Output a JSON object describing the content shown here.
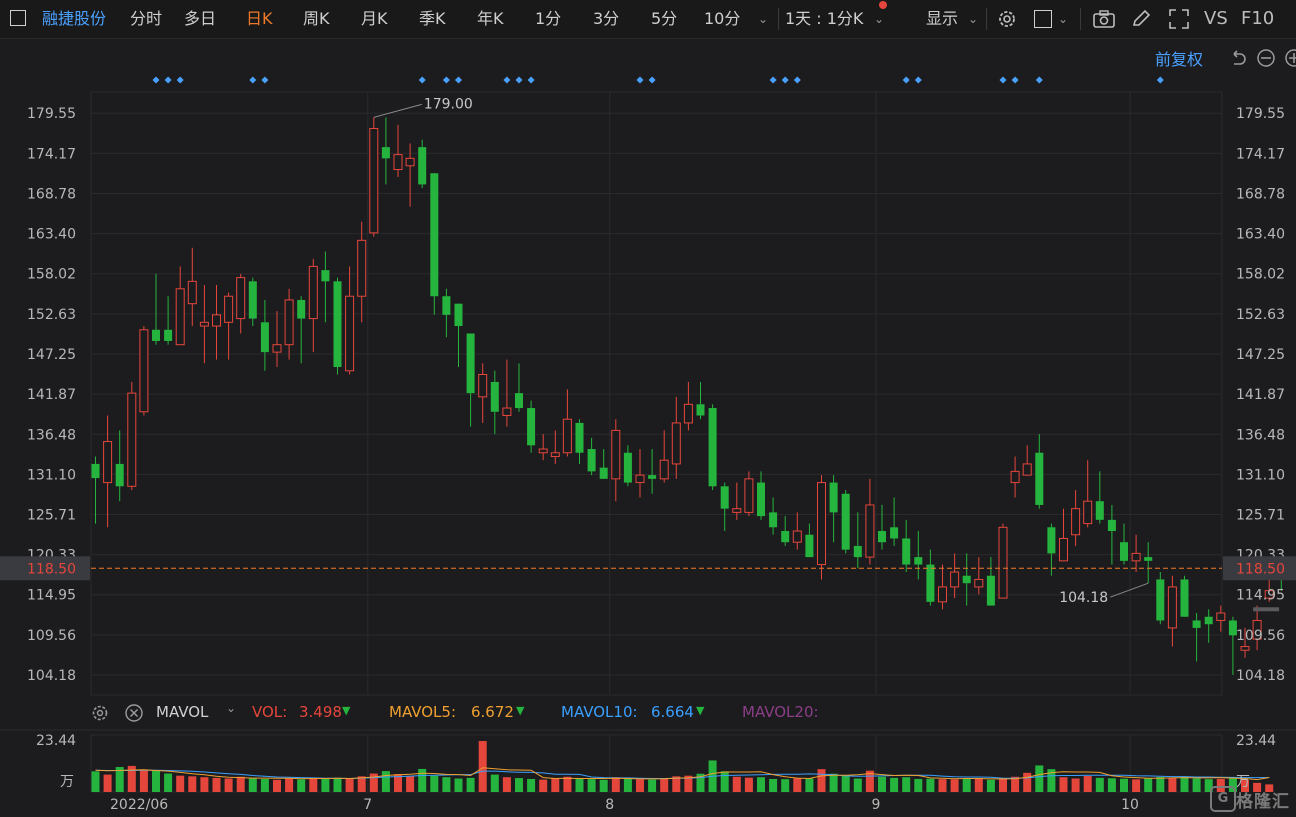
{
  "toolbar": {
    "stock_name": "融捷股份",
    "tabs": [
      "分时",
      "多日",
      "日K",
      "周K",
      "月K",
      "季K",
      "年K",
      "1分",
      "3分",
      "5分",
      "10分"
    ],
    "active_tab": "日K",
    "interval_select": "1天 : 1分K",
    "display_label": "显示",
    "vs_label": "VS",
    "f10_label": "F10",
    "adjust_label": "前复权"
  },
  "volume_bar": {
    "indicator": "MAVOL",
    "vol_label": "VOL:",
    "vol_value": "3.498",
    "mavol5_label": "MAVOL5:",
    "mavol5_value": "6.672",
    "mavol10_label": "MAVOL10:",
    "mavol10_value": "6.664",
    "mavol20_label": "MAVOL20:",
    "max_label": "23.44",
    "unit_label": "万"
  },
  "colors": {
    "up": "#e5463c",
    "down": "#25b53e",
    "accent": "#f07a2a",
    "link": "#4aa0ff",
    "mavol5": "#f0a030",
    "mavol10": "#3aa0ff",
    "mavol20": "#b04aa8"
  },
  "chart_data": {
    "type": "candlestick",
    "ylim": [
      101.5,
      182.4
    ],
    "y_ticks": [
      "179.55",
      "174.17",
      "168.78",
      "163.40",
      "158.02",
      "152.63",
      "147.25",
      "141.87",
      "136.48",
      "131.10",
      "125.71",
      "120.33",
      "114.95",
      "109.56",
      "104.18"
    ],
    "y_tick_values": [
      179.55,
      174.17,
      168.78,
      163.4,
      158.02,
      152.63,
      147.25,
      141.87,
      136.48,
      131.1,
      125.71,
      120.33,
      114.95,
      109.56,
      104.18
    ],
    "x_labels": [
      "2022/06",
      "7",
      "8",
      "9",
      "10"
    ],
    "x_label_index": [
      3,
      23,
      43,
      65,
      86
    ],
    "last_price": 118.5,
    "last_price_label": "118.50",
    "high_label": "179.00",
    "high_index": 23,
    "low_label": "104.18",
    "low_index": 87,
    "marker_index": [
      5,
      6,
      7,
      13,
      14,
      27,
      29,
      30,
      34,
      35,
      36,
      45,
      46,
      56,
      57,
      58,
      67,
      68,
      75,
      76,
      78,
      88
    ],
    "candles": [
      [
        132.5,
        130.6,
        133.5,
        124.5
      ],
      [
        130.0,
        135.5,
        139.0,
        124.0
      ],
      [
        132.5,
        129.5,
        137.0,
        127.5
      ],
      [
        129.5,
        142.0,
        143.5,
        129.0
      ],
      [
        139.5,
        150.5,
        151.0,
        139.0
      ],
      [
        150.5,
        149.0,
        158.0,
        148.5
      ],
      [
        150.5,
        149.0,
        155.0,
        148.5
      ],
      [
        148.5,
        156.0,
        159.0,
        148.5
      ],
      [
        154.0,
        157.0,
        161.5,
        151.0
      ],
      [
        151.0,
        151.5,
        156.5,
        146.0
      ],
      [
        151.0,
        152.5,
        156.5,
        146.5
      ],
      [
        151.5,
        155.0,
        155.5,
        146.5
      ],
      [
        152.0,
        157.5,
        158.0,
        150.0
      ],
      [
        157.0,
        152.0,
        157.5,
        151.0
      ],
      [
        151.5,
        147.5,
        154.5,
        145.0
      ],
      [
        147.5,
        148.5,
        153.0,
        145.5
      ],
      [
        148.5,
        154.5,
        156.0,
        146.5
      ],
      [
        154.5,
        152.0,
        155.0,
        146.0
      ],
      [
        152.0,
        159.0,
        160.0,
        147.5
      ],
      [
        158.5,
        157.0,
        161.0,
        151.5
      ],
      [
        157.0,
        145.5,
        157.5,
        144.5
      ],
      [
        145.0,
        155.0,
        159.0,
        144.5
      ],
      [
        155.0,
        162.5,
        165.0,
        151.5
      ],
      [
        163.5,
        177.5,
        179.0,
        163.0
      ],
      [
        175.0,
        173.5,
        179.0,
        170.0
      ],
      [
        172.0,
        174.0,
        178.0,
        171.0
      ],
      [
        172.5,
        173.5,
        175.5,
        167.0
      ],
      [
        175.0,
        170.0,
        176.0,
        169.5
      ],
      [
        171.5,
        155.0,
        171.5,
        152.5
      ],
      [
        155.0,
        152.5,
        156.0,
        149.5
      ],
      [
        154.0,
        151.0,
        154.0,
        145.5
      ],
      [
        150.0,
        142.0,
        150.0,
        137.5
      ],
      [
        141.5,
        144.5,
        146.0,
        138.0
      ],
      [
        143.5,
        139.5,
        145.0,
        136.5
      ],
      [
        139.0,
        140.0,
        146.5,
        137.5
      ],
      [
        142.0,
        140.0,
        146.0,
        139.5
      ],
      [
        140.0,
        135.0,
        141.0,
        134.0
      ],
      [
        134.0,
        134.5,
        136.5,
        133.0
      ],
      [
        133.5,
        134.0,
        137.0,
        132.5
      ],
      [
        134.0,
        138.5,
        142.5,
        133.5
      ],
      [
        138.0,
        134.0,
        138.5,
        132.5
      ],
      [
        134.5,
        131.5,
        136.0,
        131.0
      ],
      [
        132.0,
        130.5,
        134.5,
        130.5
      ],
      [
        130.5,
        137.0,
        138.5,
        127.5
      ],
      [
        134.0,
        130.0,
        135.0,
        129.5
      ],
      [
        130.0,
        131.0,
        134.5,
        128.0
      ],
      [
        131.0,
        130.5,
        134.5,
        128.5
      ],
      [
        130.5,
        133.0,
        137.0,
        130.0
      ],
      [
        132.5,
        138.0,
        141.5,
        130.5
      ],
      [
        138.0,
        140.5,
        143.5,
        137.0
      ],
      [
        140.5,
        139.0,
        143.5,
        138.5
      ],
      [
        140.0,
        129.5,
        140.5,
        129.0
      ],
      [
        129.5,
        126.5,
        130.0,
        123.5
      ],
      [
        126.0,
        126.5,
        130.0,
        125.0
      ],
      [
        126.0,
        130.5,
        131.5,
        125.5
      ],
      [
        130.0,
        125.5,
        131.5,
        125.0
      ],
      [
        126.0,
        124.0,
        128.0,
        123.0
      ],
      [
        123.5,
        122.0,
        125.5,
        121.5
      ],
      [
        122.0,
        123.5,
        126.0,
        121.0
      ],
      [
        123.0,
        120.0,
        124.5,
        120.0
      ],
      [
        119.0,
        130.0,
        131.0,
        117.0
      ],
      [
        130.0,
        126.0,
        131.0,
        122.0
      ],
      [
        128.5,
        121.0,
        129.0,
        120.5
      ],
      [
        121.5,
        120.0,
        126.0,
        118.5
      ],
      [
        120.0,
        127.0,
        130.5,
        119.0
      ],
      [
        123.5,
        122.0,
        127.0,
        121.0
      ],
      [
        124.0,
        122.5,
        128.0,
        121.5
      ],
      [
        122.5,
        119.0,
        125.0,
        118.0
      ],
      [
        120.0,
        119.0,
        123.5,
        117.0
      ],
      [
        119.0,
        114.0,
        121.0,
        113.5
      ],
      [
        114.0,
        116.0,
        119.0,
        113.0
      ],
      [
        116.0,
        118.0,
        120.5,
        114.5
      ],
      [
        117.5,
        116.5,
        120.5,
        113.5
      ],
      [
        116.0,
        117.0,
        120.0,
        115.0
      ],
      [
        117.5,
        113.5,
        120.0,
        113.5
      ],
      [
        114.5,
        124.0,
        124.5,
        114.5
      ],
      [
        130.0,
        131.5,
        133.5,
        128.0
      ],
      [
        131.0,
        132.5,
        135.0,
        131.0
      ],
      [
        134.0,
        127.0,
        136.5,
        126.5
      ],
      [
        124.0,
        120.5,
        124.5,
        117.5
      ],
      [
        119.5,
        122.5,
        126.5,
        119.5
      ],
      [
        123.0,
        126.5,
        129.0,
        121.5
      ],
      [
        124.5,
        127.5,
        133.0,
        124.0
      ],
      [
        127.5,
        125.0,
        131.5,
        124.5
      ],
      [
        125.0,
        123.5,
        127.0,
        119.0
      ],
      [
        122.0,
        119.5,
        124.5,
        119.0
      ],
      [
        119.5,
        120.5,
        123.0,
        118.0
      ],
      [
        120.0,
        119.5,
        122.0,
        116.5
      ],
      [
        117.0,
        111.5,
        118.0,
        111.0
      ],
      [
        110.5,
        116.0,
        117.5,
        108.0
      ],
      [
        117.0,
        112.0,
        117.5,
        112.0
      ],
      [
        111.5,
        110.5,
        112.5,
        106.0
      ],
      [
        112.0,
        111.0,
        113.0,
        108.5
      ],
      [
        111.5,
        112.5,
        113.5,
        110.0
      ],
      [
        111.5,
        109.5,
        112.0,
        104.18
      ],
      [
        107.5,
        108.0,
        110.5,
        106.5
      ],
      [
        109.0,
        111.5,
        113.5,
        107.5
      ],
      [
        114.5,
        115.5,
        118.0,
        114.0
      ],
      [
        118.5,
        118.0,
        120.0,
        115.5
      ]
    ],
    "volumes": [
      9.5,
      8.0,
      11.5,
      12.0,
      10.0,
      9.8,
      8.5,
      7.5,
      7.2,
      6.8,
      6.5,
      6.2,
      7.0,
      6.5,
      6.0,
      5.6,
      6.4,
      5.8,
      6.6,
      6.0,
      6.5,
      6.1,
      7.2,
      8.5,
      9.6,
      8.2,
      7.3,
      10.6,
      7.5,
      6.8,
      6.2,
      6.5,
      23.44,
      8.0,
      6.8,
      6.4,
      6.0,
      5.7,
      6.2,
      7.0,
      6.3,
      5.9,
      5.6,
      6.8,
      6.1,
      5.8,
      5.7,
      6.0,
      7.2,
      7.5,
      8.4,
      14.5,
      9.5,
      7.0,
      6.6,
      6.8,
      6.0,
      5.9,
      6.3,
      6.2,
      10.5,
      8.4,
      7.6,
      6.2,
      9.8,
      7.0,
      6.5,
      6.8,
      6.0,
      6.1,
      5.9,
      5.8,
      6.0,
      6.4,
      5.6,
      6.2,
      7.0,
      8.8,
      12.2,
      10.5,
      6.8,
      6.2,
      7.4,
      6.5,
      6.3,
      6.1,
      5.8,
      6.2,
      6.9,
      6.4,
      7.2,
      6.2,
      5.9,
      6.0,
      6.5,
      5.5,
      4.2,
      3.5
    ],
    "mavol5": [
      10.0,
      9.8,
      9.9,
      10.1,
      10.2,
      9.9,
      9.6,
      9.0,
      8.4,
      7.9,
      7.2,
      6.8,
      6.6,
      6.4,
      6.4,
      6.3,
      6.3,
      6.1,
      6.2,
      6.2,
      6.3,
      6.2,
      6.5,
      6.9,
      7.6,
      7.9,
      8.2,
      8.6,
      8.5,
      8.1,
      8.0,
      7.6,
      11.1,
      10.7,
      10.2,
      10.1,
      10.0,
      6.6,
      6.2,
      6.3,
      6.2,
      6.2,
      6.2,
      6.3,
      6.2,
      6.0,
      6.0,
      6.1,
      6.4,
      6.5,
      7.0,
      8.5,
      9.2,
      9.2,
      9.2,
      9.3,
      8.0,
      7.0,
      6.4,
      6.2,
      7.4,
      7.7,
      7.7,
      7.9,
      8.5,
      8.0,
      7.6,
      7.7,
      7.6,
      6.5,
      6.3,
      6.1,
      6.2,
      6.2,
      6.0,
      6.0,
      6.1,
      6.8,
      8.0,
      8.9,
      9.3,
      9.2,
      9.2,
      9.0,
      7.5,
      6.9,
      6.6,
      6.3,
      6.3,
      6.5,
      6.6,
      6.5,
      6.5,
      6.6,
      6.4,
      6.2,
      5.7,
      6.672
    ],
    "mavol10": [
      10.0,
      9.9,
      9.9,
      9.9,
      10.0,
      10.0,
      9.9,
      9.7,
      9.5,
      9.2,
      8.8,
      8.4,
      8.1,
      7.6,
      7.2,
      6.9,
      6.8,
      6.6,
      6.5,
      6.3,
      6.3,
      6.2,
      6.4,
      6.6,
      6.9,
      7.1,
      7.3,
      7.6,
      7.7,
      7.8,
      8.0,
      8.0,
      9.6,
      9.6,
      9.3,
      9.1,
      9.0,
      8.8,
      8.2,
      8.2,
      8.1,
      6.9,
      6.6,
      6.5,
      6.5,
      6.3,
      6.2,
      6.2,
      6.3,
      6.4,
      6.6,
      7.2,
      7.6,
      7.7,
      7.8,
      7.9,
      8.1,
      8.2,
      8.2,
      8.3,
      8.2,
      8.0,
      7.4,
      7.2,
      7.3,
      7.4,
      7.6,
      7.7,
      7.7,
      7.7,
      7.3,
      7.0,
      6.9,
      6.9,
      6.8,
      6.3,
      6.3,
      6.5,
      7.1,
      7.5,
      7.6,
      7.6,
      7.7,
      7.7,
      7.7,
      7.7,
      7.5,
      7.4,
      7.2,
      7.1,
      7.1,
      6.9,
      6.9,
      6.8,
      6.7,
      6.6,
      6.6,
      6.664
    ]
  }
}
